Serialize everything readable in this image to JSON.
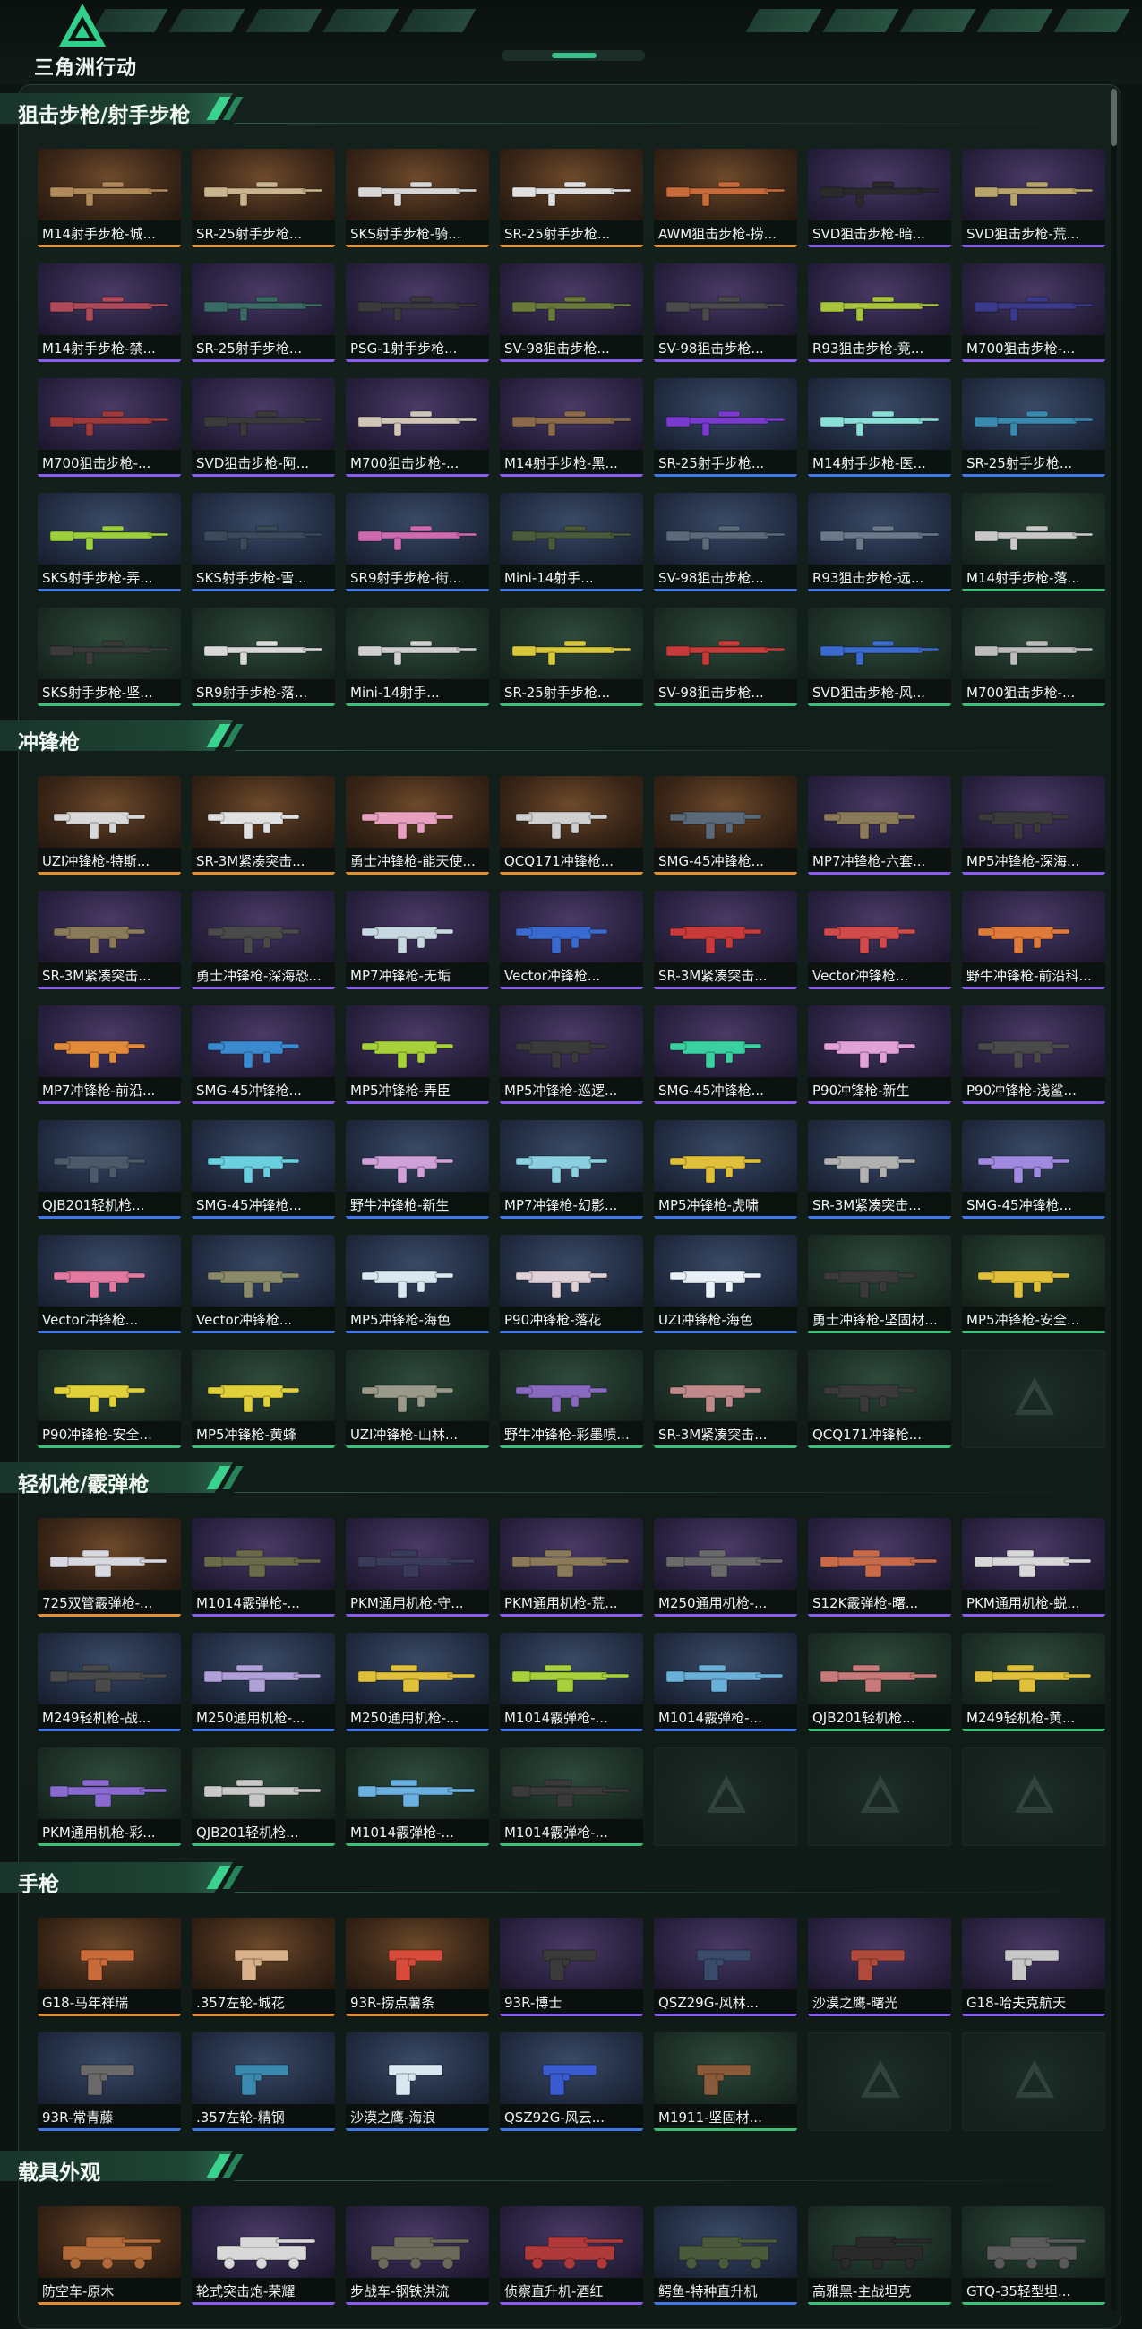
{
  "brand": {
    "name": "三角洲行动",
    "logo_icon": "delta-triangle-logo"
  },
  "sections": [
    {
      "title": "狙击步枪/射手步枪",
      "items": [
        {
          "label": "M14射手步枪-城...",
          "rarity": "gold",
          "color": "#b08a5a"
        },
        {
          "label": "SR-25射手步枪...",
          "rarity": "gold",
          "color": "#c9b48f"
        },
        {
          "label": "SKS射手步枪-骑...",
          "rarity": "gold",
          "color": "#d7d7d7"
        },
        {
          "label": "SR-25射手步枪...",
          "rarity": "gold",
          "color": "#e0e0e0"
        },
        {
          "label": "AWM狙击步枪-捞...",
          "rarity": "gold",
          "color": "#c96a3a"
        },
        {
          "label": "SVD狙击步枪-暗...",
          "rarity": "purple",
          "color": "#2a2a2a"
        },
        {
          "label": "SVD狙击步枪-荒...",
          "rarity": "purple",
          "color": "#b8a46a"
        },
        {
          "label": "M14射手步枪-禁...",
          "rarity": "purple",
          "color": "#b04a5a"
        },
        {
          "label": "SR-25射手步枪...",
          "rarity": "purple",
          "color": "#3a6a64"
        },
        {
          "label": "PSG-1射手步枪...",
          "rarity": "purple",
          "color": "#3a3a3a"
        },
        {
          "label": "SV-98狙击步枪...",
          "rarity": "purple",
          "color": "#6a7a3a"
        },
        {
          "label": "SV-98狙击步枪...",
          "rarity": "purple",
          "color": "#4a4a4a"
        },
        {
          "label": "R93狙击步枪-竞...",
          "rarity": "purple",
          "color": "#a8c43a"
        },
        {
          "label": "M700狙击步枪-...",
          "rarity": "purple",
          "color": "#3a3a8a"
        },
        {
          "label": "M700狙击步枪-...",
          "rarity": "purple",
          "color": "#a03a3a"
        },
        {
          "label": "SVD狙击步枪-阿...",
          "rarity": "purple",
          "color": "#3a3a3a"
        },
        {
          "label": "M700狙击步枪-...",
          "rarity": "purple",
          "color": "#cfc6b8"
        },
        {
          "label": "M14射手步枪-黑...",
          "rarity": "purple",
          "color": "#8a6a4a"
        },
        {
          "label": "SR-25射手步枪...",
          "rarity": "blue",
          "color": "#7a3ad0"
        },
        {
          "label": "M14射手步枪-医...",
          "rarity": "blue",
          "color": "#8ae0d8"
        },
        {
          "label": "SR-25射手步枪...",
          "rarity": "blue",
          "color": "#3a8ab0"
        },
        {
          "label": "SKS射手步枪-弄...",
          "rarity": "blue",
          "color": "#9cd03a"
        },
        {
          "label": "SKS射手步枪-雪...",
          "rarity": "blue",
          "color": "#3a4a5a"
        },
        {
          "label": "SR9射手步枪-街...",
          "rarity": "blue",
          "color": "#d06ab0"
        },
        {
          "label": "Mini-14射手...",
          "rarity": "blue",
          "color": "#4a5a3a"
        },
        {
          "label": "SV-98狙击步枪...",
          "rarity": "blue",
          "color": "#5a6a7a"
        },
        {
          "label": "R93狙击步枪-远...",
          "rarity": "blue",
          "color": "#6a7a8a"
        },
        {
          "label": "M14射手步枪-落...",
          "rarity": "green",
          "color": "#c8c8c8"
        },
        {
          "label": "SKS射手步枪-坚...",
          "rarity": "green",
          "color": "#3a3a3a"
        },
        {
          "label": "SR9射手步枪-落...",
          "rarity": "green",
          "color": "#d8d8d8"
        },
        {
          "label": "Mini-14射手...",
          "rarity": "green",
          "color": "#cfcfcf"
        },
        {
          "label": "SR-25射手步枪...",
          "rarity": "green",
          "color": "#d8c83a"
        },
        {
          "label": "SV-98狙击步枪...",
          "rarity": "green",
          "color": "#c83a3a"
        },
        {
          "label": "SVD狙击步枪-风...",
          "rarity": "green",
          "color": "#3a6ad0"
        },
        {
          "label": "M700狙击步枪-...",
          "rarity": "green",
          "color": "#bdbdbd"
        }
      ]
    },
    {
      "title": "冲锋枪",
      "items": [
        {
          "label": "UZI冲锋枪-特斯...",
          "rarity": "gold",
          "color": "#d8d8d8"
        },
        {
          "label": "SR-3M紧凑突击...",
          "rarity": "gold",
          "color": "#e0e0e0"
        },
        {
          "label": "勇士冲锋枪-能天使...",
          "rarity": "gold",
          "color": "#e8a0c0"
        },
        {
          "label": "QCQ171冲锋枪...",
          "rarity": "gold",
          "color": "#cfcfcf"
        },
        {
          "label": "SMG-45冲锋枪...",
          "rarity": "gold",
          "color": "#5a6a7a"
        },
        {
          "label": "MP7冲锋枪-六套...",
          "rarity": "purple",
          "color": "#8a7a5a"
        },
        {
          "label": "MP5冲锋枪-深海...",
          "rarity": "purple",
          "color": "#3a3a3a"
        },
        {
          "label": "SR-3M紧凑突击...",
          "rarity": "purple",
          "color": "#8a7a5a"
        },
        {
          "label": "勇士冲锋枪-深海恐...",
          "rarity": "purple",
          "color": "#4a4a4a"
        },
        {
          "label": "MP7冲锋枪-无垢",
          "rarity": "purple",
          "color": "#c8d8e0"
        },
        {
          "label": "Vector冲锋枪...",
          "rarity": "purple",
          "color": "#3a6ad0"
        },
        {
          "label": "SR-3M紧凑突击...",
          "rarity": "purple",
          "color": "#c83a3a"
        },
        {
          "label": "Vector冲锋枪...",
          "rarity": "purple",
          "color": "#d04a4a"
        },
        {
          "label": "野牛冲锋枪-前沿科...",
          "rarity": "purple",
          "color": "#e07a3a"
        },
        {
          "label": "MP7冲锋枪-前沿...",
          "rarity": "purple",
          "color": "#e08a3a"
        },
        {
          "label": "SMG-45冲锋枪...",
          "rarity": "purple",
          "color": "#3a8ad0"
        },
        {
          "label": "MP5冲锋枪-弄臣",
          "rarity": "purple",
          "color": "#a8d03a"
        },
        {
          "label": "MP5冲锋枪-巡逻...",
          "rarity": "purple",
          "color": "#3a3a3a"
        },
        {
          "label": "SMG-45冲锋枪...",
          "rarity": "purple",
          "color": "#3ad0a0"
        },
        {
          "label": "P90冲锋枪-新生",
          "rarity": "purple",
          "color": "#e0a0d8"
        },
        {
          "label": "P90冲锋枪-浅鲨...",
          "rarity": "purple",
          "color": "#4a4a4a"
        },
        {
          "label": "QJB201轻机枪...",
          "rarity": "blue",
          "color": "#4a5a6a"
        },
        {
          "label": "SMG-45冲锋枪...",
          "rarity": "blue",
          "color": "#6ad0e0"
        },
        {
          "label": "野牛冲锋枪-新生",
          "rarity": "blue",
          "color": "#d0a0d8"
        },
        {
          "label": "MP7冲锋枪-幻影...",
          "rarity": "blue",
          "color": "#8ad0e0"
        },
        {
          "label": "MP5冲锋枪-虎啸",
          "rarity": "blue",
          "color": "#e0c03a"
        },
        {
          "label": "SR-3M紧凑突击...",
          "rarity": "blue",
          "color": "#b0b0b0"
        },
        {
          "label": "SMG-45冲锋枪...",
          "rarity": "blue",
          "color": "#a08ae0"
        },
        {
          "label": "Vector冲锋枪...",
          "rarity": "blue",
          "color": "#e07aa0"
        },
        {
          "label": "Vector冲锋枪...",
          "rarity": "blue",
          "color": "#8a8a6a"
        },
        {
          "label": "MP5冲锋枪-海色",
          "rarity": "blue",
          "color": "#d8e8f0"
        },
        {
          "label": "P90冲锋枪-落花",
          "rarity": "blue",
          "color": "#e0d0d8"
        },
        {
          "label": "UZI冲锋枪-海色",
          "rarity": "blue",
          "color": "#e8f0f8"
        },
        {
          "label": "勇士冲锋枪-坚固材...",
          "rarity": "green",
          "color": "#3a3a3a"
        },
        {
          "label": "MP5冲锋枪-安全...",
          "rarity": "green",
          "color": "#e0c03a"
        },
        {
          "label": "P90冲锋枪-安全...",
          "rarity": "green",
          "color": "#e0d03a"
        },
        {
          "label": "MP5冲锋枪-黄蜂",
          "rarity": "green",
          "color": "#e0d03a"
        },
        {
          "label": "UZI冲锋枪-山林...",
          "rarity": "green",
          "color": "#9a9a8a"
        },
        {
          "label": "野牛冲锋枪-彩墨喷...",
          "rarity": "green",
          "color": "#8a6ac0"
        },
        {
          "label": "SR-3M紧凑突击...",
          "rarity": "green",
          "color": "#c08a8a"
        },
        {
          "label": "QCQ171冲锋枪...",
          "rarity": "green",
          "color": "#3a3a3a"
        },
        {
          "label": "",
          "rarity": "empty",
          "color": ""
        }
      ]
    },
    {
      "title": "轻机枪/霰弹枪",
      "items": [
        {
          "label": "725双管霰弹枪-...",
          "rarity": "gold",
          "color": "#d8d8e0"
        },
        {
          "label": "M1014霰弹枪-...",
          "rarity": "purple",
          "color": "#6a6a4a"
        },
        {
          "label": "PKM通用机枪-守...",
          "rarity": "purple",
          "color": "#3a3a5a"
        },
        {
          "label": "PKM通用机枪-荒...",
          "rarity": "purple",
          "color": "#8a7a5a"
        },
        {
          "label": "M250通用机枪-...",
          "rarity": "purple",
          "color": "#6a6a6a"
        },
        {
          "label": "S12K霰弹枪-曙...",
          "rarity": "purple",
          "color": "#c86a4a"
        },
        {
          "label": "PKM通用机枪-蜕...",
          "rarity": "purple",
          "color": "#d8d8d8"
        },
        {
          "label": "M249轻机枪-战...",
          "rarity": "blue",
          "color": "#4a4a4a"
        },
        {
          "label": "M250通用机枪-...",
          "rarity": "blue",
          "color": "#b0a0d8"
        },
        {
          "label": "M250通用机枪-...",
          "rarity": "blue",
          "color": "#e0c03a"
        },
        {
          "label": "M1014霰弹枪-...",
          "rarity": "blue",
          "color": "#a8d03a"
        },
        {
          "label": "M1014霰弹枪-...",
          "rarity": "blue",
          "color": "#6ab0d8"
        },
        {
          "label": "QJB201轻机枪...",
          "rarity": "green",
          "color": "#c87a7a"
        },
        {
          "label": "M249轻机枪-黄...",
          "rarity": "green",
          "color": "#e0c03a"
        },
        {
          "label": "PKM通用机枪-彩...",
          "rarity": "green",
          "color": "#8a6ad0"
        },
        {
          "label": "QJB201轻机枪...",
          "rarity": "green",
          "color": "#c8c8c8"
        },
        {
          "label": "M1014霰弹枪-...",
          "rarity": "green",
          "color": "#6ab0e0"
        },
        {
          "label": "M1014霰弹枪-...",
          "rarity": "green",
          "color": "#3a3a3a"
        },
        {
          "label": "",
          "rarity": "empty",
          "color": ""
        },
        {
          "label": "",
          "rarity": "empty",
          "color": ""
        },
        {
          "label": "",
          "rarity": "empty",
          "color": ""
        }
      ]
    },
    {
      "title": "手枪",
      "items": [
        {
          "label": "G18-马年祥瑞",
          "rarity": "gold",
          "color": "#c86a3a"
        },
        {
          "label": ".357左轮-城花",
          "rarity": "gold",
          "color": "#d8b08a"
        },
        {
          "label": "93R-捞点薯条",
          "rarity": "gold",
          "color": "#d84a3a"
        },
        {
          "label": "93R-博士",
          "rarity": "purple",
          "color": "#3a3a3a"
        },
        {
          "label": "QSZ29G-风林...",
          "rarity": "purple",
          "color": "#3a4a6a"
        },
        {
          "label": "沙漠之鹰-曙光",
          "rarity": "purple",
          "color": "#b04a3a"
        },
        {
          "label": "G18-哈夫克航天",
          "rarity": "purple",
          "color": "#c8c8c8"
        },
        {
          "label": "93R-常青藤",
          "rarity": "blue",
          "color": "#6a6a6a"
        },
        {
          "label": ".357左轮-精钢",
          "rarity": "blue",
          "color": "#3a8ab0"
        },
        {
          "label": "沙漠之鹰-海浪",
          "rarity": "blue",
          "color": "#d8e8f0"
        },
        {
          "label": "QSZ92G-风云...",
          "rarity": "blue",
          "color": "#3a5ad0"
        },
        {
          "label": "M1911-坚固材...",
          "rarity": "green",
          "color": "#8a5a3a"
        },
        {
          "label": "",
          "rarity": "empty",
          "color": ""
        },
        {
          "label": "",
          "rarity": "empty",
          "color": ""
        }
      ]
    },
    {
      "title": "载具外观",
      "items": [
        {
          "label": "防空车-原木",
          "rarity": "gold",
          "color": "#b06a3a"
        },
        {
          "label": "轮式突击炮-荣耀",
          "rarity": "purple",
          "color": "#d8d8d8"
        },
        {
          "label": "步战车-钢铁洪流",
          "rarity": "purple",
          "color": "#6a6a5a"
        },
        {
          "label": "侦察直升机-酒红",
          "rarity": "purple",
          "color": "#b03a3a"
        },
        {
          "label": "鳄鱼-特种直升机",
          "rarity": "blue",
          "color": "#4a5a3a"
        },
        {
          "label": "高雅黑-主战坦克",
          "rarity": "green",
          "color": "#2a2a2a"
        },
        {
          "label": "GTQ-35轻型坦...",
          "rarity": "green",
          "color": "#5a5a5a"
        }
      ]
    }
  ]
}
